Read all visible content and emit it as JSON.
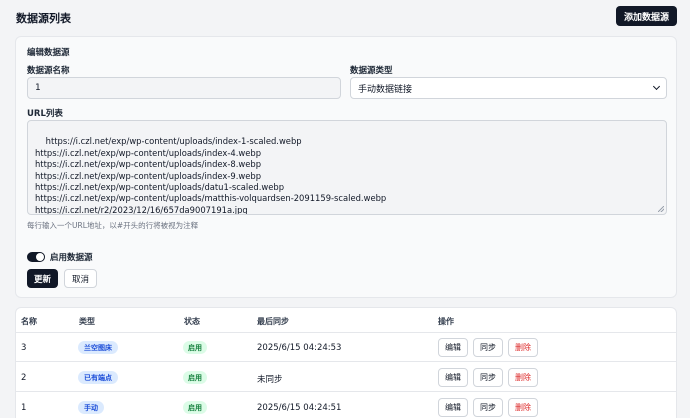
{
  "page": {
    "title": "数据源列表",
    "add_label": "添加数据源"
  },
  "edit": {
    "title": "编辑数据源",
    "name_label": "数据源名称",
    "name_value": "1",
    "type_label": "数据源类型",
    "type_value": "手动数据链接",
    "url_label": "URL列表",
    "urls": "https://i.czl.net/exp/wp-content/uploads/index-1-scaled.webp\nhttps://i.czl.net/exp/wp-content/uploads/index-4.webp\nhttps://i.czl.net/exp/wp-content/uploads/index-8.webp\nhttps://i.czl.net/exp/wp-content/uploads/index-9.webp\nhttps://i.czl.net/exp/wp-content/uploads/datu1-scaled.webp\nhttps://i.czl.net/exp/wp-content/uploads/matthis-volquardsen-2091159-scaled.webp\nhttps://i.czl.net/r2/2023/12/16/657da9007191a.jpg",
    "hint": "每行输入一个URL地址，以#开头的行将被视为注释",
    "enable_label": "启用数据源",
    "enabled": true,
    "update_label": "更新",
    "cancel_label": "取消"
  },
  "table": {
    "headers": {
      "name": "名称",
      "type": "类型",
      "status": "状态",
      "last_sync": "最后同步",
      "actions": "操作"
    },
    "rows": [
      {
        "name": "3",
        "type": "兰空图床",
        "status": "启用",
        "last_sync": "2025/6/15 04:24:53"
      },
      {
        "name": "2",
        "type": "已有端点",
        "status": "启用",
        "last_sync": "未同步"
      },
      {
        "name": "1",
        "type": "手动",
        "status": "启用",
        "last_sync": "2025/6/15 04:24:51"
      }
    ],
    "actions": {
      "edit": "编辑",
      "sync": "同步",
      "delete": "删除"
    }
  },
  "colors": {
    "primary": "#111827",
    "badge_blue": "#1d4ed8",
    "badge_green": "#15803d",
    "danger": "#dc2626"
  }
}
